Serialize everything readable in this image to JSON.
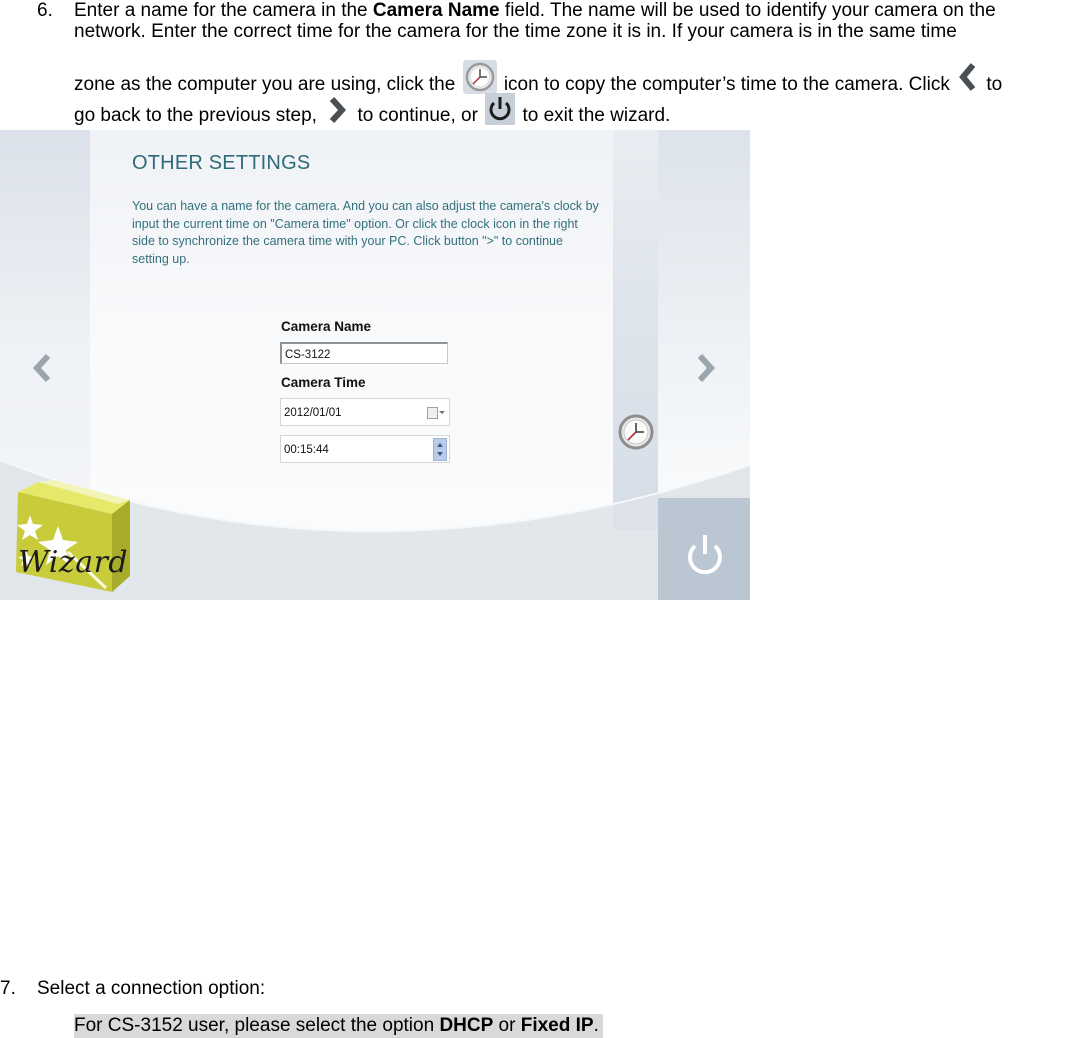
{
  "step6": {
    "number": "6.",
    "line1_a": "Enter a name for the camera in the ",
    "line1_bold": "Camera Name",
    "line1_b": " field. The name will be used to identify your camera on the",
    "line2": "network. Enter the correct time for the camera for the time zone it is in. If your camera is in the same time",
    "line3_a": "zone as the computer you are using, click the ",
    "line3_b": " icon to copy the computer’s time to the camera. Click ",
    "line3_c": " to",
    "line4_a": "go back to the previous step, ",
    "line4_b": " to continue, or ",
    "line4_c": " to exit the wizard.",
    "inline_icons": [
      "clock-icon",
      "chevron-left-icon",
      "chevron-right-icon",
      "power-icon"
    ]
  },
  "wizard": {
    "title": "OTHER SETTINGS",
    "description": "You can have a name for the camera. And you can also adjust the camera's clock by input the current time on \"Camera time\" option. Or click the clock icon in the right side to synchronize the camera time with your PC. Click button \">\" to continue setting up.",
    "camera_name_label": "Camera Name",
    "camera_name_value": "CS-3122",
    "camera_time_label": "Camera Time",
    "date_value": "2012/01/01",
    "time_value": "00:15:44",
    "logo_text": "Wizard",
    "icons": {
      "prev": "chevron-left-icon",
      "next": "chevron-right-icon",
      "sync": "clock-icon",
      "exit": "power-icon",
      "calendar": "calendar-icon"
    },
    "colors": {
      "title": "#2f6a78",
      "text": "#33707c",
      "logo_box": "#c9cc3a",
      "spin": "#b9cdea"
    }
  },
  "step7": {
    "number": "7.",
    "text": "Select a connection option:",
    "note_a": "For CS-3152 user, please select the  option ",
    "note_bold1": "DHCP",
    "note_b": " or ",
    "note_bold2": "Fixed IP",
    "note_c": "."
  }
}
